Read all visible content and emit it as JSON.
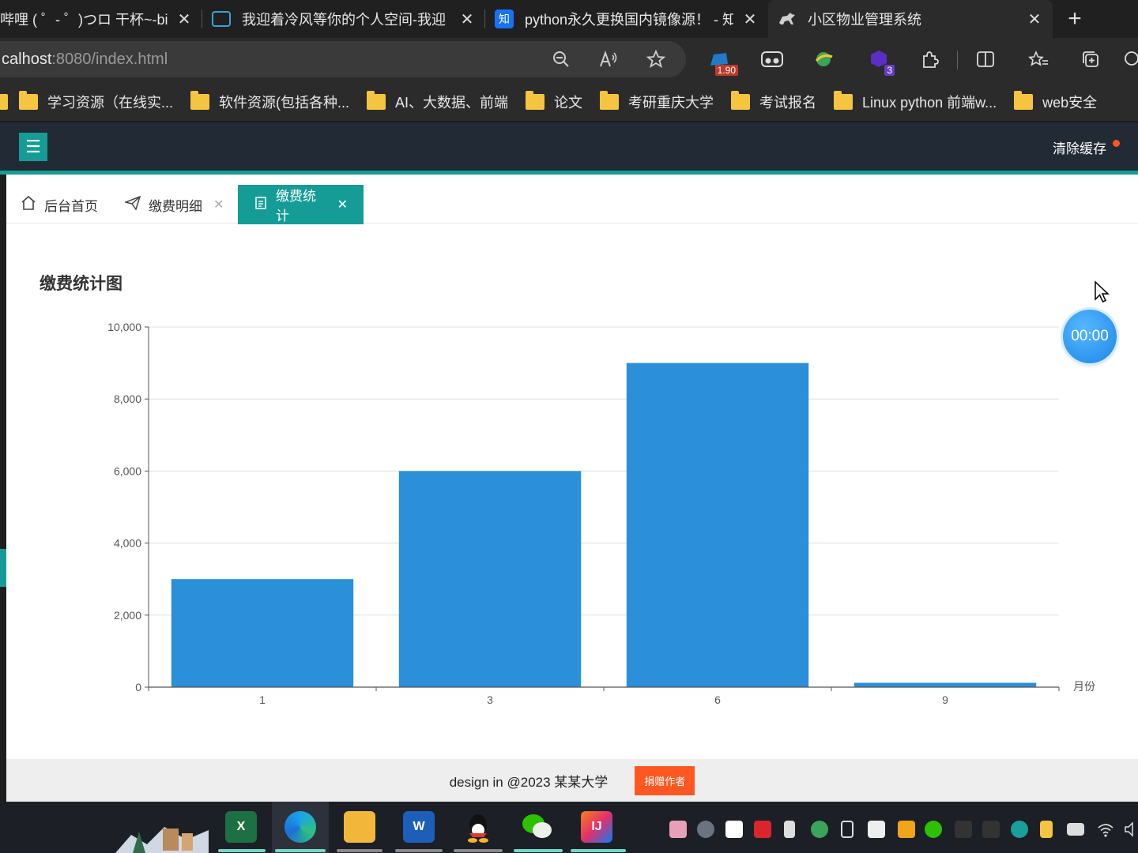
{
  "browser": {
    "tabs": [
      {
        "title": "哔哩 ( ゜- ゜)つロ 干杯~-bilib",
        "close": "✕"
      },
      {
        "title": "我迎着冷风等你的个人空间-我迎",
        "close": "✕"
      },
      {
        "title": "python永久更换国内镜像源！ - 知",
        "close": "✕"
      },
      {
        "title": "小区物业管理系统",
        "close": "✕"
      }
    ],
    "new_tab": "+",
    "favicon_zhihu": "知",
    "url_host": "calhost",
    "url_rest": ":8080/index.html",
    "ext_badge_1": "1.90",
    "ext_badge_2": "3",
    "bookmarks": [
      "学习资源（在线实...",
      "软件资源(包括各种...",
      "AI、大数据、前端",
      "论文",
      "考研重庆大学",
      "考试报名",
      "Linux python 前端w...",
      "web安全"
    ]
  },
  "app": {
    "menu_icon": "☰",
    "clear_cache": "清除缓存",
    "tabs": [
      {
        "label": "后台首页"
      },
      {
        "label": "缴费明细",
        "close": "✕"
      },
      {
        "label": "缴费统计",
        "close": "✕"
      }
    ],
    "timer": "00:00",
    "footer_text": "design in @2023 某某大学",
    "donate_label": "捐赠作者"
  },
  "chart_data": {
    "type": "bar",
    "title": "缴费统计图",
    "xlabel": "月份",
    "ylabel": "",
    "categories": [
      "1",
      "3",
      "6",
      "9"
    ],
    "values": [
      3000,
      6000,
      9000,
      120
    ],
    "ylim": [
      0,
      10000
    ],
    "yticks": [
      "0",
      "2,000",
      "4,000",
      "6,000",
      "8,000",
      "10,000"
    ],
    "grid": true,
    "bar_color": "#2b8fd9"
  },
  "colors": {
    "accent": "#169c97",
    "header_bg": "#222a35",
    "donate": "#ff5722"
  }
}
